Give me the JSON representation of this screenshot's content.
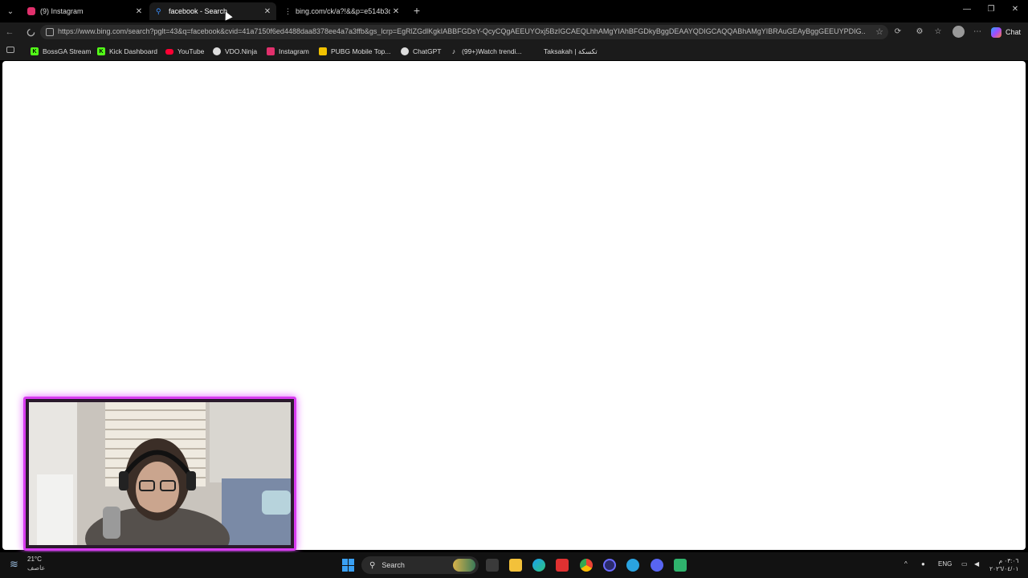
{
  "tabs": [
    {
      "label": "(9) Instagram",
      "icon": "instagram-icon",
      "color": "#e1306c",
      "active": false
    },
    {
      "label": "facebook - Search",
      "icon": "search-icon",
      "color": "#3a8fff",
      "active": true
    },
    {
      "label": "bing.com/ck/a?!&&p=e514b3d6c...",
      "icon": "more-vert-icon",
      "color": "#cccccc",
      "active": false
    }
  ],
  "address_bar": {
    "url": "https://www.bing.com/search?pglt=43&q=facebook&cvid=41a7150f6ed4488daa8378ee4a7a3ffb&gs_lcrp=EgRlZGdlKgkIABBFGDsY-QcyCQgAEEUYOxj5BzIGCAEQLhhAMgYIAhBFGDkyBggDEAAYQDIGCAQQABhAMgYIBRAuGEAyBggGEEUYPDIG..."
  },
  "toolbar": {
    "chat_label": "Chat"
  },
  "bookmarks": [
    {
      "label": "BossGA Stream",
      "icon": "kick-icon",
      "color": "#53fc18"
    },
    {
      "label": "Kick Dashboard",
      "icon": "kick-icon",
      "color": "#53fc18"
    },
    {
      "label": "YouTube",
      "icon": "youtube-icon",
      "color": "#ff0033"
    },
    {
      "label": "VDO.Ninja",
      "icon": "vdo-ninja-icon",
      "color": "#dddddd"
    },
    {
      "label": "Instagram",
      "icon": "instagram-icon",
      "color": "#e1306c"
    },
    {
      "label": "PUBG Mobile Top...",
      "icon": "pubg-icon",
      "color": "#f2c200"
    },
    {
      "label": "ChatGPT",
      "icon": "chatgpt-icon",
      "color": "#dddddd"
    },
    {
      "label": "(99+)Watch trendi...",
      "icon": "tiktok-icon",
      "color": "#dddddd"
    },
    {
      "label": "Taksakah | تكسكة",
      "icon": "blank-icon",
      "color": "#1b1b1b"
    }
  ],
  "taskbar": {
    "weather_temp": "21°C",
    "weather_cond": "عاصف",
    "search_label": "Search",
    "language": "ENG",
    "time": "٠٣:٠٦ م",
    "date": "٢٠٢٦/٠٤/٠١"
  },
  "colors": {
    "webcam_border": "#d83bf0",
    "page_bg": "#ffffff",
    "chrome_bg": "#1b1b1b"
  }
}
